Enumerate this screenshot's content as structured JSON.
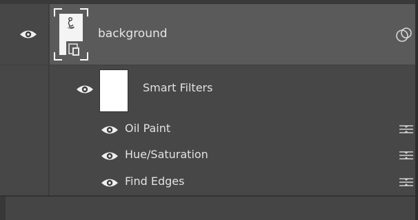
{
  "layer": {
    "name": "background",
    "visible_icon": "eye-icon",
    "effects_icon": "smart-object-filters-icon"
  },
  "smart_filters": {
    "label": "Smart Filters",
    "visible_icon": "eye-icon",
    "filters": [
      {
        "label": "Oil Paint",
        "visible_icon": "eye-icon",
        "options_icon": "filter-blending-options-icon"
      },
      {
        "label": "Hue/Saturation",
        "visible_icon": "eye-icon",
        "options_icon": "filter-blending-options-icon"
      },
      {
        "label": "Find Edges",
        "visible_icon": "eye-icon",
        "options_icon": "filter-blending-options-icon"
      }
    ]
  },
  "colors": {
    "panel_bg": "#474747",
    "selected_row": "#5a5a5a",
    "text": "#e6e6e6"
  }
}
